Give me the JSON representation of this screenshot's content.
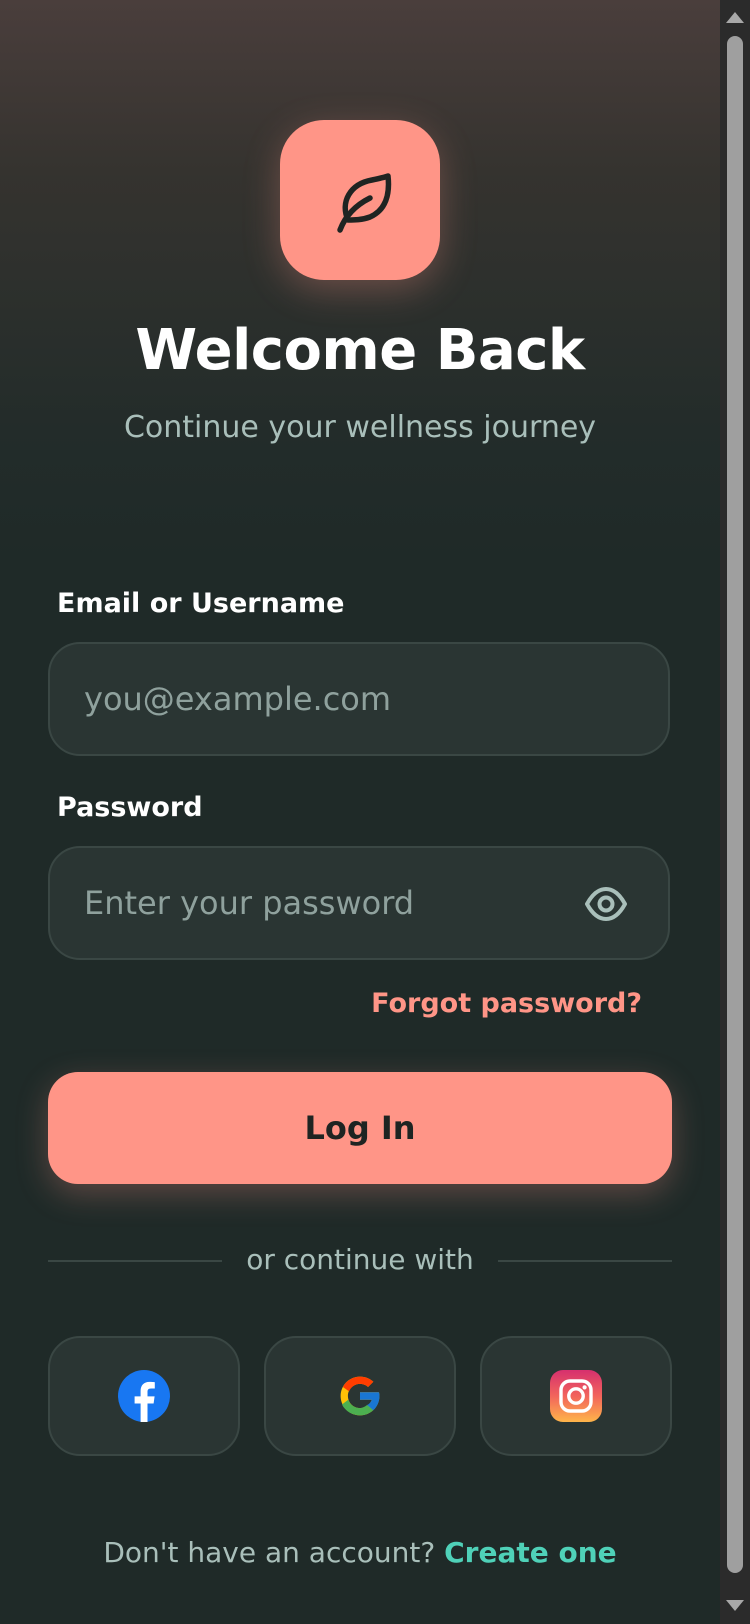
{
  "header": {
    "logo_icon": "leaf-icon",
    "title": "Welcome Back",
    "subtitle": "Continue your wellness journey"
  },
  "form": {
    "email_label": "Email or Username",
    "email_placeholder": "you@example.com",
    "password_label": "Password",
    "password_placeholder": "Enter your password",
    "password_toggle_icon": "eye-icon",
    "forgot_label": "Forgot password?",
    "login_label": "Log In"
  },
  "divider": {
    "text": "or continue with"
  },
  "social": [
    {
      "icon": "facebook-icon"
    },
    {
      "icon": "google-icon"
    },
    {
      "icon": "instagram-icon"
    }
  ],
  "footer": {
    "prompt": "Don't have an account? ",
    "link": "Create one"
  },
  "colors": {
    "accent": "#ff9587",
    "link": "#4fd1b8",
    "background": "#1f2a28",
    "field": "#2a3533"
  }
}
